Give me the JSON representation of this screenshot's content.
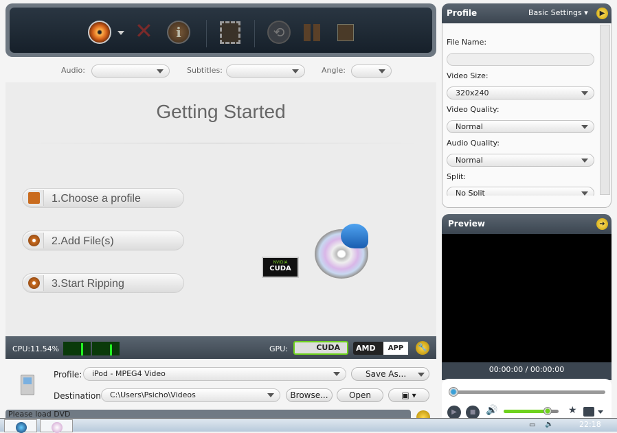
{
  "toolbar": {
    "icons": [
      "dvd-disc-icon",
      "dropdown-arrow-icon",
      "remove-icon",
      "info-icon",
      "add-clip-icon",
      "refresh-icon",
      "pause-icon",
      "stop-icon"
    ]
  },
  "tracks": {
    "audio_label": "Audio:",
    "subtitles_label": "Subtitles:",
    "angle_label": "Angle:",
    "audio_value": "",
    "subtitles_value": "",
    "angle_value": ""
  },
  "getting_started": {
    "title": "Getting Started",
    "steps": [
      "1.Choose a profile",
      "2.Add File(s)",
      "3.Start Ripping"
    ],
    "cuda_badge_top": "NVIDIA",
    "cuda_badge": "CUDA"
  },
  "status": {
    "cpu": "CPU:11.54%",
    "gpu_label": "GPU:",
    "cuda": "CUDA",
    "amd": "AMD",
    "app": "APP"
  },
  "output": {
    "profile_label": "Profile:",
    "profile_value": "iPod - MPEG4 Video",
    "save_as": "Save As...",
    "destination_label": "Destination:",
    "destination_value": "C:\\Users\\Psicho\\Videos",
    "browse": "Browse...",
    "open": "Open",
    "status_text": "Please load DVD"
  },
  "profile_panel": {
    "title": "Profile",
    "mode": "Basic Settings",
    "file_name_label": "File Name:",
    "file_name_value": "",
    "video_size_label": "Video Size:",
    "video_size_value": "320x240",
    "video_quality_label": "Video Quality:",
    "video_quality_value": "Normal",
    "audio_quality_label": "Audio Quality:",
    "audio_quality_value": "Normal",
    "split_label": "Split:",
    "split_value": "No Split"
  },
  "preview": {
    "title": "Preview",
    "time": "00:00:00 / 00:00:00",
    "seek_fraction": 0,
    "volume_fraction": 0.8
  },
  "taskbar": {
    "clock": "22:18"
  },
  "colors": {
    "accent_green": "#6fd21e",
    "panel_dark": "#3b4550"
  }
}
